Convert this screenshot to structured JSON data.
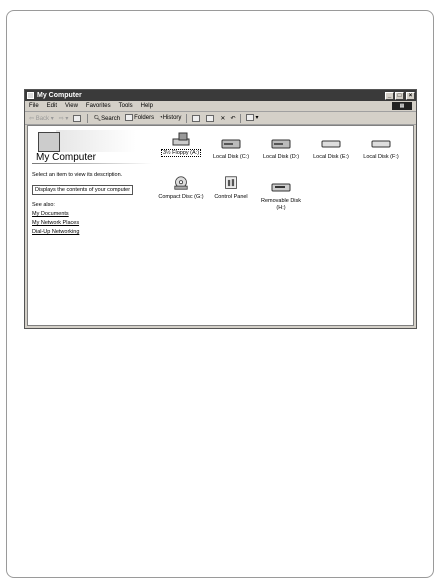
{
  "window": {
    "title": "My Computer",
    "controls": [
      "_",
      "□",
      "×"
    ]
  },
  "menu": [
    "File",
    "Edit",
    "View",
    "Favorites",
    "Tools",
    "Help"
  ],
  "toolbar": {
    "back": "Back",
    "search": "Search",
    "folders": "Folders",
    "history": "History"
  },
  "left_panel": {
    "heading": "My Computer",
    "prompt": "Select an item to view its description.",
    "description": "Displays the contents of your computer",
    "see_also": "See also:",
    "links": [
      "My Documents",
      "My Network Places",
      "Dial-Up Networking"
    ]
  },
  "drives": [
    {
      "label": "3½ Floppy (A:)",
      "icon": "floppy-drive-icon"
    },
    {
      "label": "Local Disk (C:)",
      "icon": "hard-disk-icon"
    },
    {
      "label": "Local Disk (D:)",
      "icon": "hard-disk-icon"
    },
    {
      "label": "Local Disk (E:)",
      "icon": "hard-disk-icon"
    },
    {
      "label": "Local Disk (F:)",
      "icon": "hard-disk-icon"
    },
    {
      "label": "Compact Disc (G:)",
      "icon": "cd-drive-icon"
    },
    {
      "label": "Control Panel",
      "icon": "control-panel-icon"
    },
    {
      "label": "Removable Disk (H:)",
      "icon": "removable-disk-icon"
    }
  ]
}
